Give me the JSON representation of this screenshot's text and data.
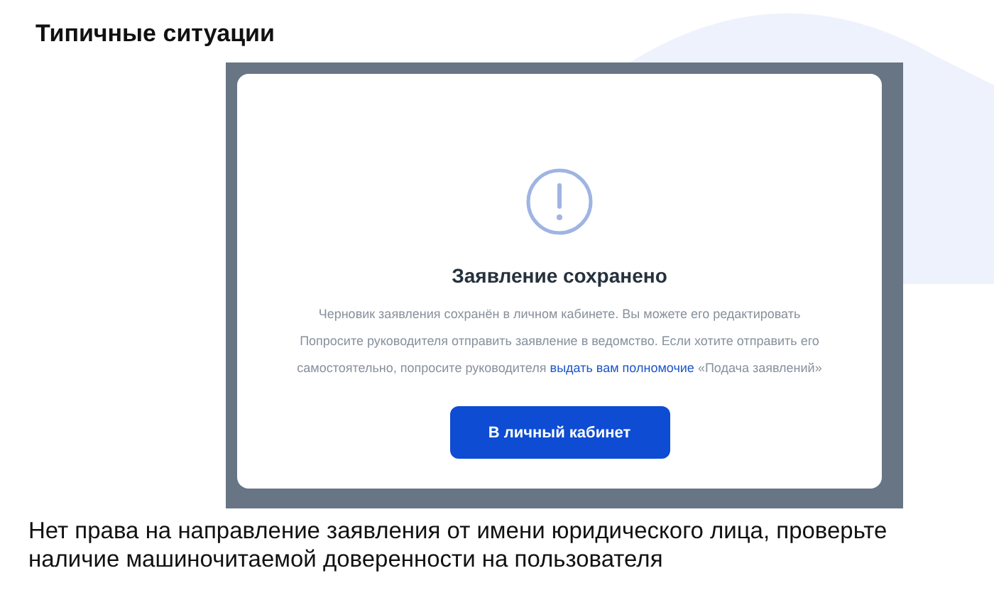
{
  "slide": {
    "title": "Типичные ситуации",
    "caption": "Нет права на направление заявления от имени юридического лица, проверьте наличие машиночитаемой доверенности на пользователя"
  },
  "dialog": {
    "title": "Заявление сохранено",
    "message": "Черновик заявления сохранён в личном кабинете. Вы можете его редактировать",
    "note": {
      "before": "Попросите руководителя отправить заявление в ведомство. Если хотите отправить его самостоятельно, попросите руководителя",
      "link": "выдать вам полномочие",
      "after": "«Подача заявлений»"
    },
    "button": "В личный кабинет"
  }
}
